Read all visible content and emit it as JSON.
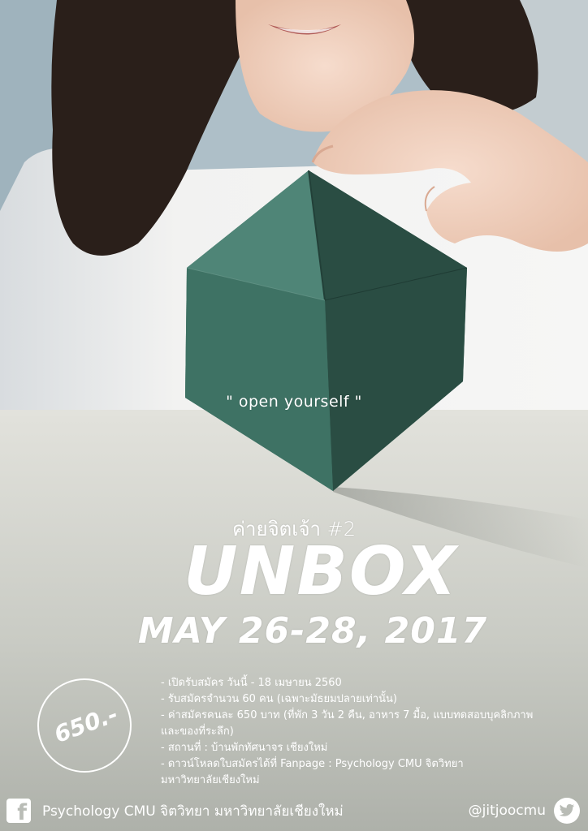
{
  "poster": {
    "tagline": "\" open yourself \"",
    "camp_name": "ค่ายจิตเจ้า #2",
    "event_title": "UNBOX",
    "event_dates": "MAY 26-28, 2017",
    "price": "650.-",
    "details": [
      "- เปิดรับสมัคร วันนี้ - 18 เมษายน 2560",
      "- รับสมัครจำนวน 60 คน (เฉพาะมัธยมปลายเท่านั้น)",
      "- ค่าสมัครคนละ 650 บาท (ที่พัก 3 วัน 2 คืน, อาหาร 7 มื้อ, แบบทดสอบบุคลิกภาพ",
      "และของที่ระลึก)",
      "- สถานที่ : บ้านพักทัศนาจร เชียงใหม่",
      "- ดาวน์โหลดใบสมัครได้ที่ Fanpage : Psychology CMU จิตวิทยา",
      "มหาวิทยาลัยเชียงใหม่"
    ],
    "footer": {
      "facebook_label": "Psychology CMU จิตวิทยา มหาวิทยาลัยเชียงใหม่",
      "twitter_handle": "@jitjoocmu",
      "facebook_icon": "facebook-icon",
      "twitter_icon": "twitter-icon"
    }
  }
}
